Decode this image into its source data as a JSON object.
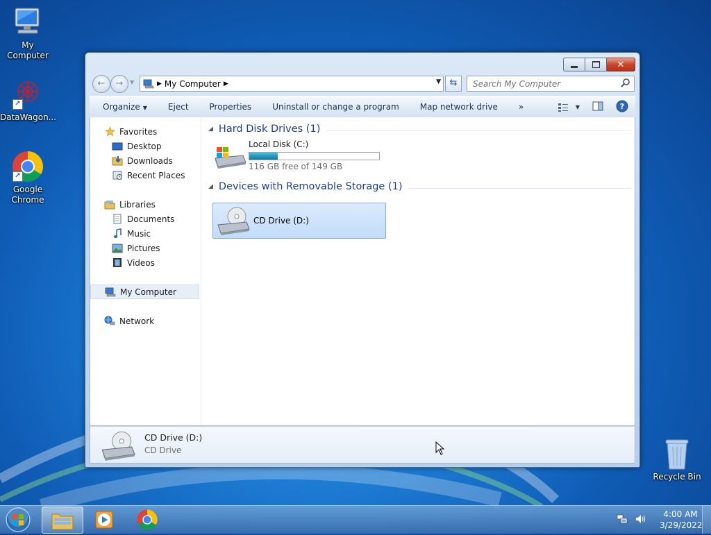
{
  "desktop": {
    "icons": [
      {
        "label": "My Computer"
      },
      {
        "label": "DataWagon..."
      },
      {
        "label": "Google Chrome"
      },
      {
        "label": "Recycle Bin"
      }
    ]
  },
  "window": {
    "address": {
      "root_icon": "computer-icon",
      "path": [
        "My Computer"
      ]
    },
    "search_placeholder": "Search My Computer",
    "toolbar": {
      "organize": "Organize",
      "eject": "Eject",
      "properties": "Properties",
      "uninstall": "Uninstall or change a program",
      "map_drive": "Map network drive",
      "more": "»"
    },
    "nav": {
      "favorites": "Favorites",
      "desktop": "Desktop",
      "downloads": "Downloads",
      "recent": "Recent Places",
      "libraries": "Libraries",
      "documents": "Documents",
      "music": "Music",
      "pictures": "Pictures",
      "videos": "Videos",
      "computer": "My Computer",
      "network": "Network"
    },
    "groups": {
      "hdd": "Hard Disk Drives (1)",
      "removable": "Devices with Removable Storage (1)"
    },
    "drives": {
      "c": {
        "name": "Local Disk (C:)",
        "free_text": "116 GB free of 149 GB",
        "used_fraction": 0.22
      },
      "d": {
        "name": "CD Drive (D:)"
      }
    },
    "details": {
      "title": "CD Drive (D:)",
      "subtitle": "CD Drive"
    }
  },
  "taskbar": {
    "time": "4:00 AM",
    "date": "3/29/2022"
  },
  "colors": {
    "accent": "#1e3f8a",
    "selection": "#c1dcfa",
    "progress": "#2597bd"
  }
}
